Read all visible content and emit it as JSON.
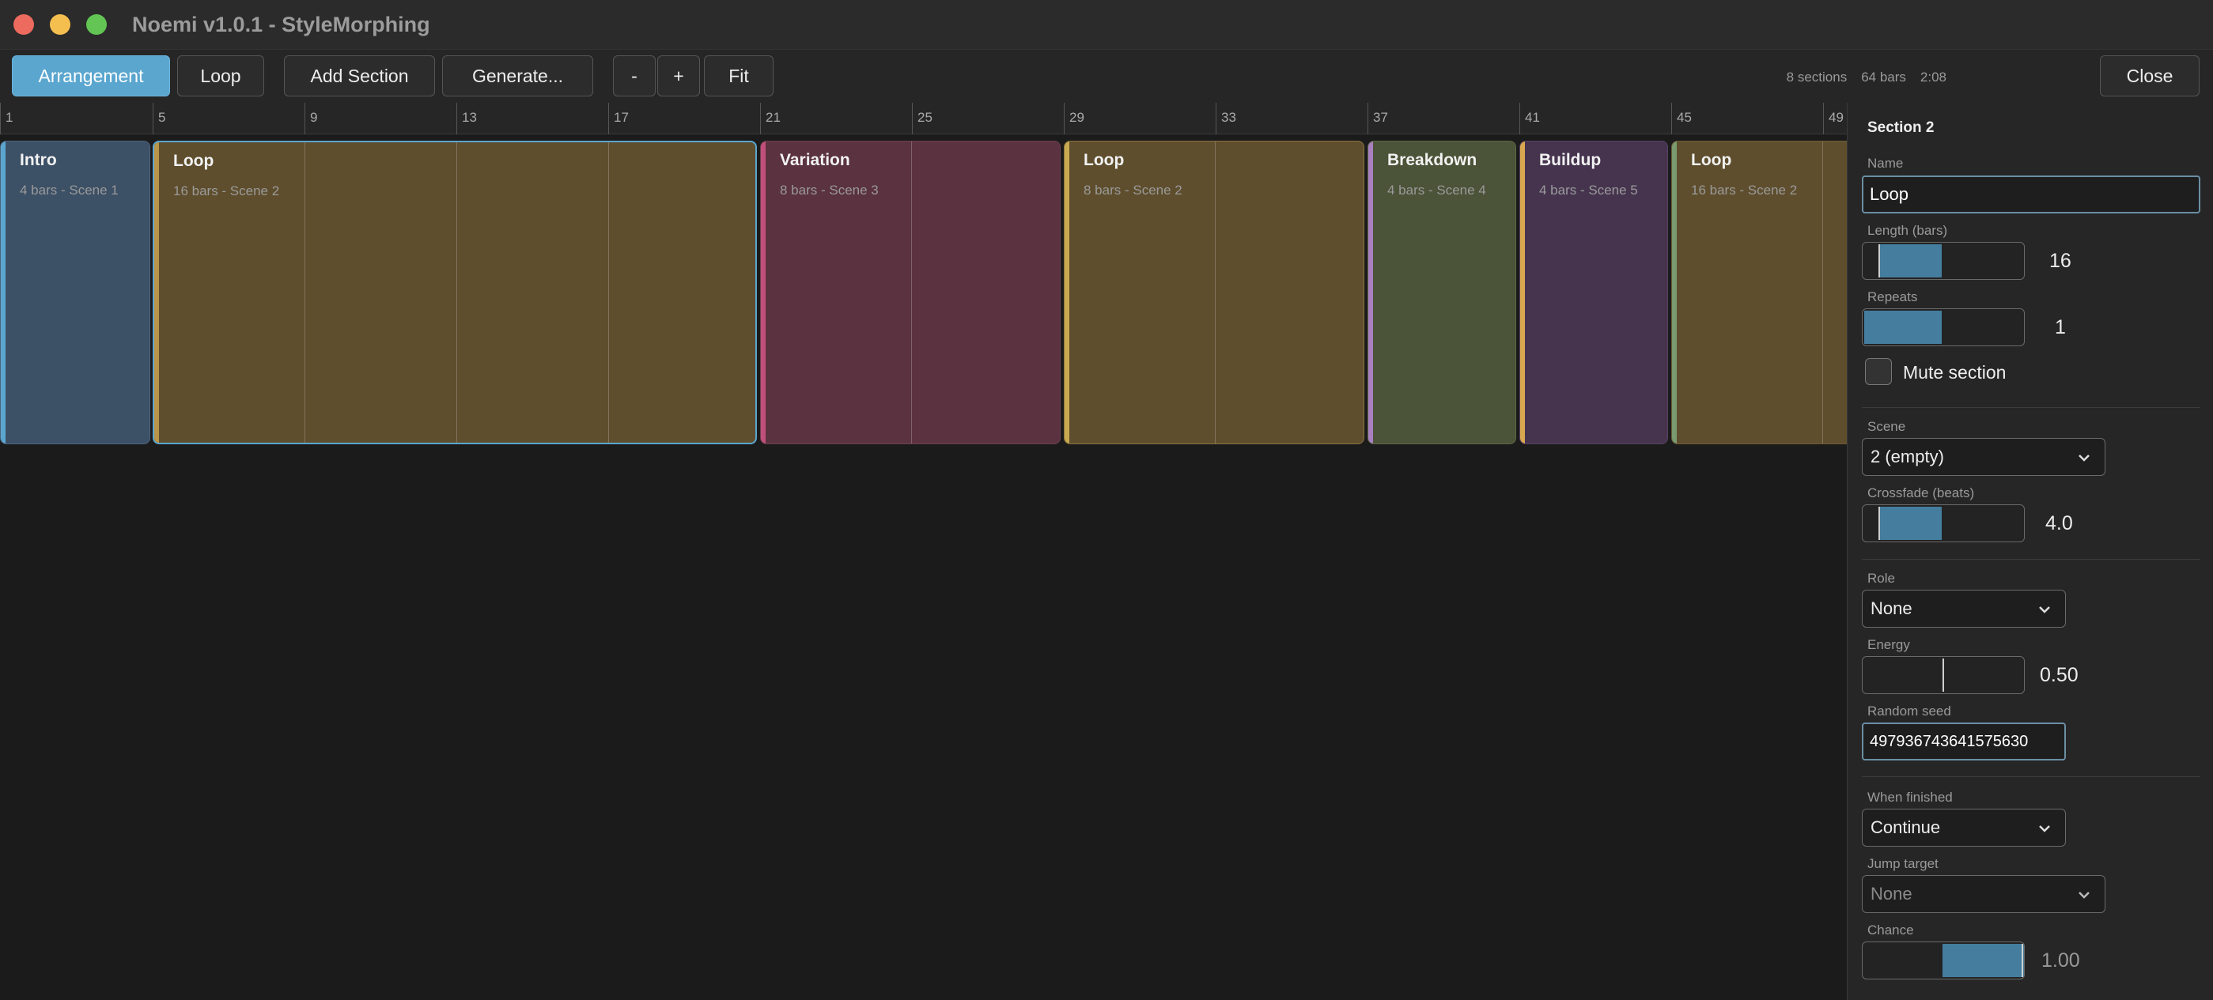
{
  "window": {
    "title": "Noemi v1.0.1 - StyleMorphing"
  },
  "toolbar": {
    "arrangement": "Arrangement",
    "loop": "Loop",
    "add_section": "Add Section",
    "generate": "Generate...",
    "zoom_out": "-",
    "zoom_in": "+",
    "fit": "Fit",
    "stats": {
      "sections": "8 sections",
      "bars": "64 bars",
      "duration": "2:08"
    },
    "close": "Close"
  },
  "ruler": {
    "labels": [
      "1",
      "5",
      "9",
      "13",
      "17",
      "21",
      "25",
      "29",
      "33",
      "37",
      "41",
      "45",
      "49"
    ]
  },
  "colors": {
    "intro": "#3c5066",
    "loop": "#5e4e2d",
    "variation": "#5b3240",
    "breakdown": "#4b5338",
    "buildup": "#46344f",
    "accent": "#5aa6cf"
  },
  "sections": [
    {
      "name": "Intro",
      "info": "4 bars  -  Scene 1"
    },
    {
      "name": "Loop",
      "info": "16 bars  -  Scene 2"
    },
    {
      "name": "Variation",
      "info": "8 bars  -  Scene 3"
    },
    {
      "name": "Loop",
      "info": "8 bars  -  Scene 2"
    },
    {
      "name": "Breakdown",
      "info": "4 bars  -  Scene 4"
    },
    {
      "name": "Buildup",
      "info": "4 bars  -  Scene 5"
    },
    {
      "name": "Loop",
      "info": "16 bars  -  Scene 2"
    }
  ],
  "inspector": {
    "title": "Section 2",
    "name_label": "Name",
    "name_value": "Loop",
    "length_label": "Length (bars)",
    "length_value": "16",
    "length_fraction": 0.3,
    "repeats_label": "Repeats",
    "repeats_value": "1",
    "repeats_fraction": 0.3,
    "mute_label": "Mute section",
    "mute_checked": false,
    "scene_label": "Scene",
    "scene_value": "2 (empty)",
    "crossfade_label": "Crossfade (beats)",
    "crossfade_value": "4.0",
    "crossfade_fraction": 0.3,
    "role_label": "Role",
    "role_value": "None",
    "energy_label": "Energy",
    "energy_value": "0.50",
    "energy_fraction": 0.5,
    "seed_label": "Random seed",
    "seed_value": "497936743641575630",
    "finished_label": "When finished",
    "finished_value": "Continue",
    "jump_label": "Jump target",
    "jump_value": "None",
    "chance_label": "Chance",
    "chance_value": "1.00",
    "chance_fraction": 1.0
  },
  "icons": {
    "chevron": "chevron-down-icon"
  }
}
